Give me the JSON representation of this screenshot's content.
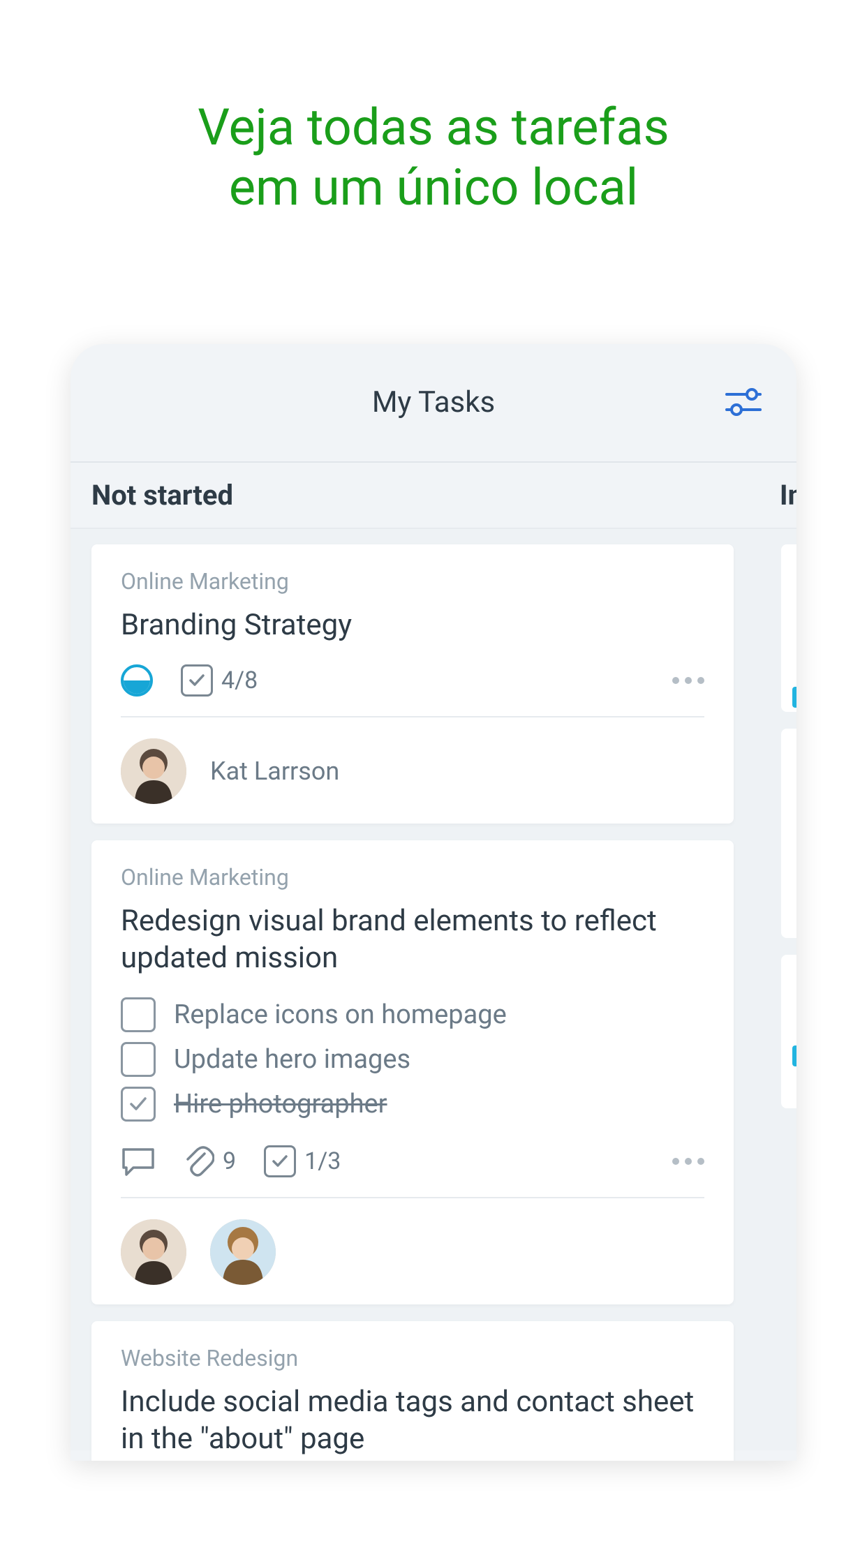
{
  "promo": {
    "line1": "Veja todas as tarefas",
    "line2": "em um único local"
  },
  "header": {
    "title": "My Tasks"
  },
  "columns": {
    "main": "Not started",
    "peek": "In"
  },
  "cards": [
    {
      "category": "Online Marketing",
      "title": "Branding Strategy",
      "checklist_count": "4/8",
      "assignee": "Kat Larrson"
    },
    {
      "category": "Online Marketing",
      "title": "Redesign visual brand elements to reflect updated mission",
      "checklist": [
        {
          "label": "Replace icons on homepage",
          "done": false
        },
        {
          "label": "Update hero images",
          "done": false
        },
        {
          "label": "Hire photographer",
          "done": true
        }
      ],
      "attachments": "9",
      "checklist_count": "1/3"
    },
    {
      "category": "Website Redesign",
      "title": "Include social media tags and contact sheet in the \"about\" page"
    }
  ]
}
